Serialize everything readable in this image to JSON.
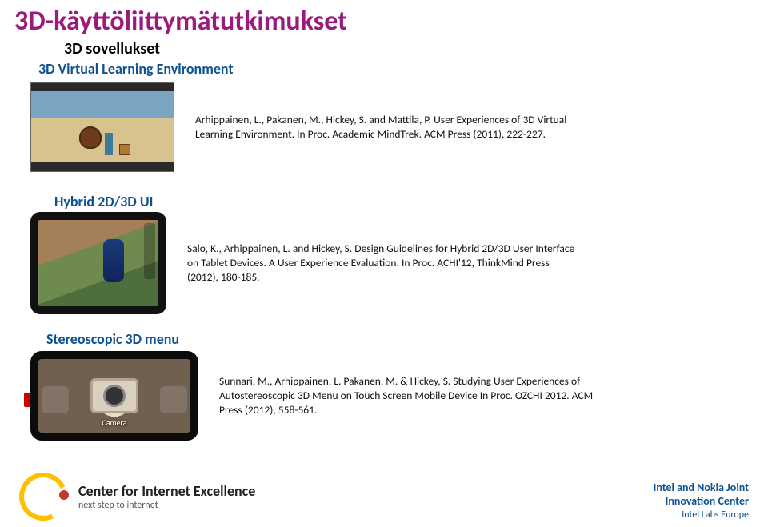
{
  "title": "3D-käyttöliittymätutkimukset",
  "subtitle1": "3D sovellukset",
  "sections": {
    "vle": {
      "heading": "3D Virtual Learning Environment",
      "citation": "Arhippainen, L., Pakanen, M., Hickey, S. and Mattila, P. User Experiences of 3D Virtual Learning Environment. In Proc. Academic MindTrek. ACM Press (2011), 222-227."
    },
    "hybrid": {
      "heading": "Hybrid 2D/3D UI",
      "citation": "Salo, K., Arhippainen, L. and Hickey, S. Design Guidelines for Hybrid 2D/3D User Interface on Tablet Devices. A User Experience Evaluation. In Proc. ACHI'12, ThinkMind Press (2012), 180-185."
    },
    "stereo": {
      "heading": "Stereoscopic 3D menu",
      "camera_label": "Camera",
      "citation": "Sunnari, M., Arhippainen, L. Pakanen, M. & Hickey, S. Studying User Experiences of Autostereoscopic 3D Menu on Touch Screen Mobile Device  In Proc. OZCHI 2012. ACM Press (2012), 558-561."
    }
  },
  "footer": {
    "cie_line1": "Center for Internet Excellence",
    "cie_line2": "next step to internet",
    "jic_line1": "Intel and Nokia Joint",
    "jic_line2": "Innovation Center",
    "jic_line3": "Intel Labs Europe"
  }
}
